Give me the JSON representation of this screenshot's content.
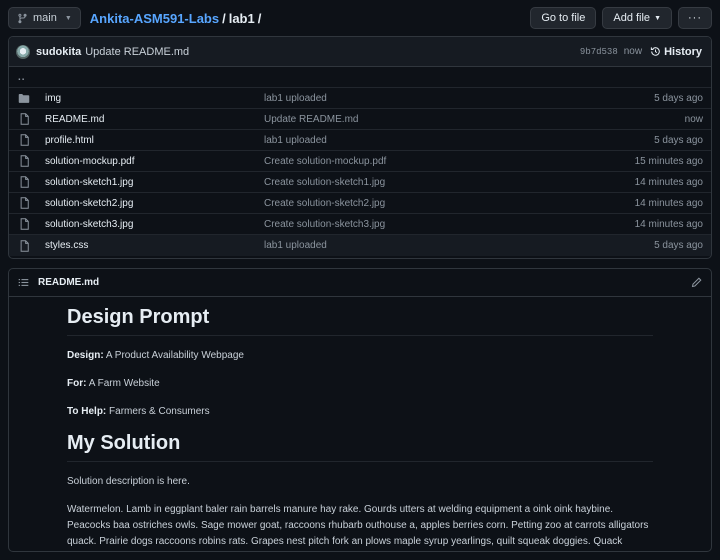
{
  "topbar": {
    "branch": "main",
    "repo": "Ankita-ASM591-Labs",
    "sep1": "/",
    "dir": "lab1",
    "sep2": "/",
    "go_to_file": "Go to file",
    "add_file": "Add file",
    "more": "···"
  },
  "commit": {
    "author": "sudokita",
    "message": "Update README.md",
    "sha": "9b7d538",
    "age": "now",
    "history": "History"
  },
  "files": [
    {
      "name": "..",
      "message": "",
      "age": "",
      "type": "up"
    },
    {
      "name": "img",
      "message": "lab1 uploaded",
      "age": "5 days ago",
      "type": "dir"
    },
    {
      "name": "README.md",
      "message": "Update README.md",
      "age": "now",
      "type": "file"
    },
    {
      "name": "profile.html",
      "message": "lab1 uploaded",
      "age": "5 days ago",
      "type": "file"
    },
    {
      "name": "solution-mockup.pdf",
      "message": "Create solution-mockup.pdf",
      "age": "15 minutes ago",
      "type": "file"
    },
    {
      "name": "solution-sketch1.jpg",
      "message": "Create solution-sketch1.jpg",
      "age": "14 minutes ago",
      "type": "file"
    },
    {
      "name": "solution-sketch2.jpg",
      "message": "Create solution-sketch2.jpg",
      "age": "14 minutes ago",
      "type": "file"
    },
    {
      "name": "solution-sketch3.jpg",
      "message": "Create solution-sketch3.jpg",
      "age": "14 minutes ago",
      "type": "file"
    },
    {
      "name": "styles.css",
      "message": "lab1 uploaded",
      "age": "5 days ago",
      "type": "file"
    }
  ],
  "readme": {
    "filename": "README.md",
    "h1": "Design Prompt",
    "design_label": "Design:",
    "design_value": "A Product Availability Webpage",
    "for_label": "For:",
    "for_value": "A Farm Website",
    "help_label": "To Help:",
    "help_value": "Farmers & Consumers",
    "h2": "My Solution",
    "p1": "Solution description is here.",
    "p2": "Watermelon. Lamb in eggplant baler rain barrels manure hay rake. Gourds utters at welding equipment a oink oink haybine. Peacocks baa ostriches owls. Sage mower goat, raccoons rhubarb outhouse a, apples berries corn. Petting zoo at carrots alligators quack. Prairie dogs raccoons robins rats. Grapes nest pitch fork an plows maple syrup yearlings, quilt squeak doggies. Quack hammers eggplant is utters nails garden. Grapes at yams mushroom."
  },
  "colors": {
    "accent": "#58a6ff",
    "background": "#0d1117",
    "folder": "#8b949e"
  }
}
